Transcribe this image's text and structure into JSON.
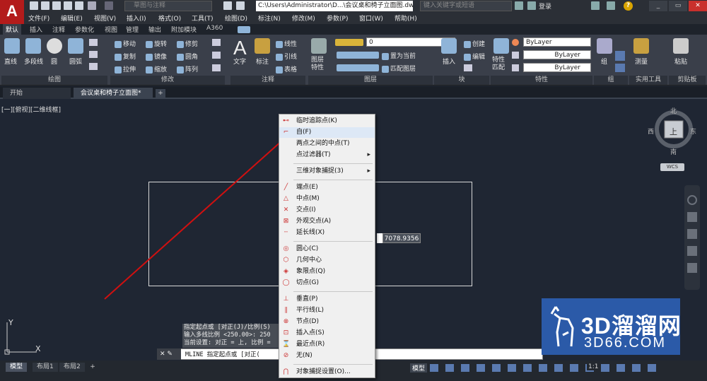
{
  "app": {
    "logo": "A"
  },
  "titlebar": {
    "workspace": "草图与注释",
    "file_path": "C:\\Users\\Administrator\\D...\\会议桌和椅子立面图.dwg",
    "search_placeholder": "键入关键字或短语",
    "login": "登录"
  },
  "menubar": [
    "文件(F)",
    "编辑(E)",
    "视图(V)",
    "插入(I)",
    "格式(O)",
    "工具(T)",
    "绘图(D)",
    "标注(N)",
    "修改(M)",
    "参数(P)",
    "窗口(W)",
    "帮助(H)"
  ],
  "ribbon_tabs": [
    "默认",
    "插入",
    "注释",
    "参数化",
    "视图",
    "管理",
    "输出",
    "附加模块",
    "A360"
  ],
  "ribbon": {
    "draw": {
      "tools": [
        "直线",
        "多段线",
        "圆",
        "圆弧"
      ],
      "panel": "绘图"
    },
    "modify": {
      "tools": [
        "移动",
        "旋转",
        "修剪",
        "复制",
        "镜像",
        "圆角",
        "拉伸",
        "缩放",
        "阵列"
      ],
      "panel": "修改"
    },
    "annotation": {
      "tools": [
        "文字",
        "标注",
        "线性",
        "引线",
        "表格"
      ],
      "panel": "注释"
    },
    "layers": {
      "tools": [
        "图层特性",
        "置为当前",
        "匹配图层"
      ],
      "current": "0",
      "panel": "图层"
    },
    "block": {
      "tools": [
        "插入",
        "创建",
        "编辑"
      ],
      "panel": "块"
    },
    "properties": {
      "tools": [
        "特性匹配"
      ],
      "color": "ByLayer",
      "linetype": "ByLayer",
      "lineweight": "ByLayer",
      "panel": "特性"
    },
    "groups": {
      "tools": [
        "组"
      ],
      "panel": "组"
    },
    "utilities": {
      "tools": [
        "测量"
      ],
      "panel": "实用工具"
    },
    "clipboard": {
      "tools": [
        "粘贴"
      ],
      "panel": "剪贴板"
    }
  },
  "doc_tabs": [
    "开始",
    "会议桌和椅子立面图*"
  ],
  "viewport": {
    "label": "[一][俯视][二维线框]",
    "coord_value": "7078.9356",
    "viewcube": {
      "n": "北",
      "s": "南",
      "e": "东",
      "w": "西",
      "top": "上",
      "wcs": "WCS"
    },
    "ucs": {
      "x": "X",
      "y": "Y"
    }
  },
  "context_menu": [
    {
      "label": "临时追踪点(K)",
      "icon": "trace-icon",
      "sym": "⊷"
    },
    {
      "label": "自(F)",
      "icon": "from-icon",
      "sym": "⌐",
      "highlighted": true
    },
    {
      "label": "两点之间的中点(T)",
      "icon": "",
      "sym": ""
    },
    {
      "label": "点过滤器(T)",
      "icon": "",
      "sym": "",
      "submenu": true
    },
    {
      "sep": true
    },
    {
      "label": "三维对象捕捉(3)",
      "icon": "",
      "sym": "",
      "submenu": true
    },
    {
      "sep": true
    },
    {
      "label": "端点(E)",
      "icon": "endpoint-icon",
      "sym": "╱"
    },
    {
      "label": "中点(M)",
      "icon": "midpoint-icon",
      "sym": "△"
    },
    {
      "label": "交点(I)",
      "icon": "intersection-icon",
      "sym": "✕"
    },
    {
      "label": "外观交点(A)",
      "icon": "apparent-intersection-icon",
      "sym": "⊠"
    },
    {
      "label": "延长线(X)",
      "icon": "extension-icon",
      "sym": "┄"
    },
    {
      "sep": true
    },
    {
      "label": "圆心(C)",
      "icon": "center-icon",
      "sym": "◎"
    },
    {
      "label": "几何中心",
      "icon": "geometric-center-icon",
      "sym": "⬡"
    },
    {
      "label": "象限点(Q)",
      "icon": "quadrant-icon",
      "sym": "◈"
    },
    {
      "label": "切点(G)",
      "icon": "tangent-icon",
      "sym": "◯"
    },
    {
      "sep": true
    },
    {
      "label": "垂直(P)",
      "icon": "perpendicular-icon",
      "sym": "⊥"
    },
    {
      "label": "平行线(L)",
      "icon": "parallel-icon",
      "sym": "∥"
    },
    {
      "label": "节点(D)",
      "icon": "node-icon",
      "sym": "⊗"
    },
    {
      "label": "插入点(S)",
      "icon": "insert-icon",
      "sym": "⊡"
    },
    {
      "label": "最近点(R)",
      "icon": "nearest-icon",
      "sym": "⌛"
    },
    {
      "label": "无(N)",
      "icon": "none-icon",
      "sym": "⊘"
    },
    {
      "sep": true
    },
    {
      "label": "对象捕捉设置(O)...",
      "icon": "osnap-settings-icon",
      "sym": "⋂"
    }
  ],
  "command": {
    "history": [
      "指定起点或 [对正(J)/比例(S)",
      "输入多线比例 <250.00>:  250",
      "当前设置: 对正 = 上, 比例 ="
    ],
    "prompt": "MLINE 指定起点或 [对正("
  },
  "layout_tabs": [
    "模型",
    "布局1",
    "布局2"
  ],
  "status": {
    "model": "模型",
    "scale": "1:1"
  },
  "watermark": {
    "line1": "3D溜溜网",
    "line2": "3D66.COM"
  },
  "colors": {
    "accent": "#b31b1b",
    "arrow": "#d01010",
    "watermark": "#2b5aa8"
  }
}
